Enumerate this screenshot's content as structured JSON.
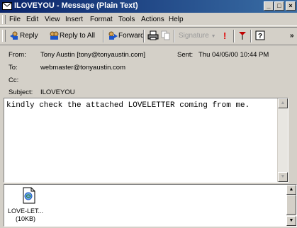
{
  "window": {
    "title": "ILOVEYOU - Message (Plain Text)",
    "min_label": "_",
    "max_label": "□",
    "close_label": "×"
  },
  "menu": {
    "items": [
      "File",
      "Edit",
      "View",
      "Insert",
      "Format",
      "Tools",
      "Actions",
      "Help"
    ]
  },
  "toolbar": {
    "reply": "Reply",
    "reply_all": "Reply to All",
    "forward": "Forward",
    "signature": "Signature",
    "more": "»"
  },
  "header": {
    "from_label": "From:",
    "from_value": "Tony Austin [tony@tonyaustin.com]",
    "sent_label": "Sent:",
    "sent_value": "Thu 04/05/00 10:44 PM",
    "to_label": "To:",
    "to_value": "webmaster@tonyaustin.com",
    "cc_label": "Cc:",
    "cc_value": "",
    "subject_label": "Subject:",
    "subject_value": "ILOVEYOU"
  },
  "message": {
    "body": "kindly check the attached LOVELETTER coming from me."
  },
  "attachment": {
    "name": "LOVE-LET...",
    "size": "(10KB)"
  }
}
